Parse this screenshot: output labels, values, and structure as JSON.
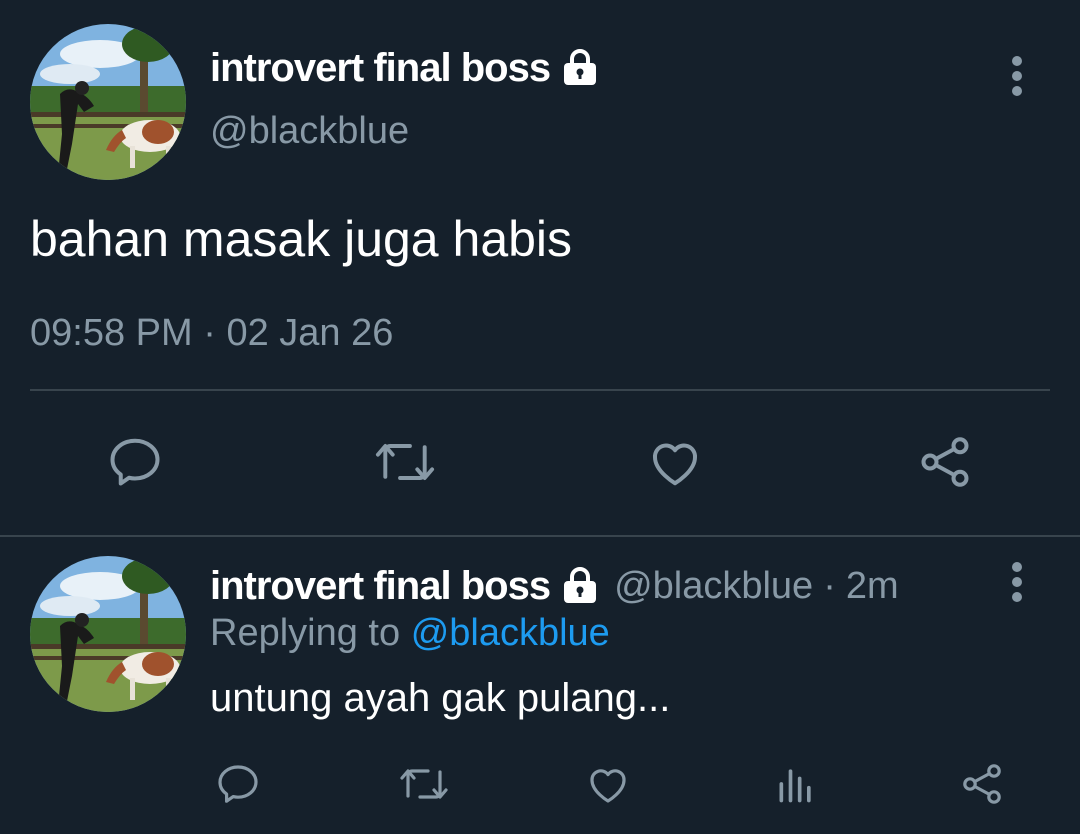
{
  "main_tweet": {
    "display_name": "introvert final boss",
    "handle": "@blackblue",
    "text": "bahan masak juga habis",
    "timestamp": "09:58 PM",
    "separator": "·",
    "date": "02 Jan 26",
    "actions": [
      "reply-icon",
      "retweet-icon",
      "like-icon",
      "share-icon"
    ]
  },
  "reply_tweet": {
    "display_name": "introvert final boss",
    "handle": "@blackblue",
    "separator": "·",
    "time_ago": "2m",
    "replying_to_label": "Replying to",
    "replying_to_handle": "@blackblue",
    "text": "untung ayah gak pulang...",
    "actions": [
      "reply-icon",
      "retweet-icon",
      "like-icon",
      "analytics-icon",
      "share-icon"
    ]
  },
  "colors": {
    "background": "#15202b",
    "text_primary": "#ffffff",
    "text_secondary": "#8899a6",
    "link": "#1d9bf0",
    "divider": "#38444d"
  }
}
